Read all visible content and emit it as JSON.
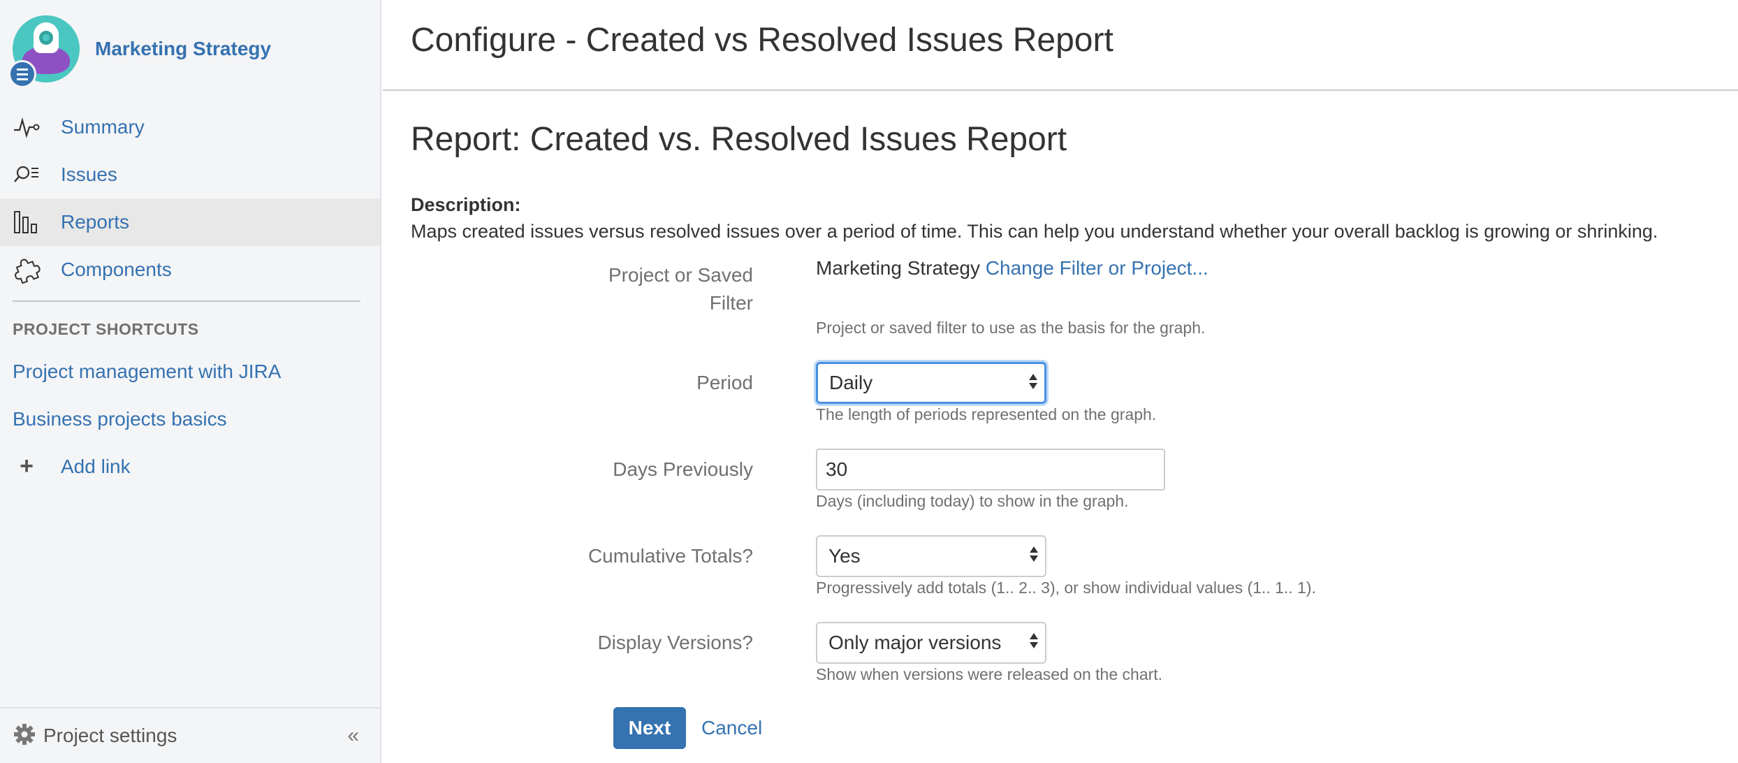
{
  "sidebar": {
    "project_name": "Marketing Strategy",
    "nav": [
      {
        "label": "Summary",
        "icon": "pulse-icon",
        "active": false
      },
      {
        "label": "Issues",
        "icon": "issues-search-icon",
        "active": false
      },
      {
        "label": "Reports",
        "icon": "bar-chart-icon",
        "active": true
      },
      {
        "label": "Components",
        "icon": "puzzle-icon",
        "active": false
      }
    ],
    "shortcuts_title": "PROJECT SHORTCUTS",
    "shortcuts": [
      "Project management with JIRA",
      "Business projects basics"
    ],
    "add_link_label": "Add link",
    "settings_label": "Project settings",
    "collapse_glyph": "«"
  },
  "main": {
    "page_title": "Configure - Created vs Resolved Issues Report",
    "report_title": "Report: Created vs. Resolved Issues Report",
    "description_label": "Description:",
    "description_text": "Maps created issues versus resolved issues over a period of time. This can help you understand whether your overall backlog is growing or shrinking.",
    "fields": {
      "filter": {
        "label_line1": "Project or Saved",
        "label_line2": "Filter",
        "current": "Marketing Strategy",
        "change_link": "Change Filter or Project...",
        "hint": "Project or saved filter to use as the basis for the graph."
      },
      "period": {
        "label": "Period",
        "value": "Daily",
        "hint": "The length of periods represented on the graph."
      },
      "days": {
        "label": "Days Previously",
        "value": "30",
        "hint": "Days (including today) to show in the graph."
      },
      "cumulative": {
        "label": "Cumulative Totals?",
        "value": "Yes",
        "hint": "Progressively add totals (1.. 2.. 3), or show individual values (1.. 1.. 1)."
      },
      "versions": {
        "label": "Display Versions?",
        "value": "Only major versions",
        "hint": "Show when versions were released on the chart."
      }
    },
    "buttons": {
      "next": "Next",
      "cancel": "Cancel"
    }
  },
  "colors": {
    "link": "#3572b0",
    "primary_button": "#3572b0",
    "sidebar_bg": "#f4f5f7",
    "focus": "#4a90e2"
  }
}
